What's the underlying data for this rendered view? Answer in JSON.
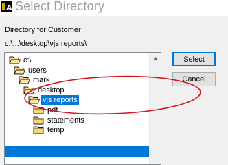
{
  "window": {
    "title": "Select Directory"
  },
  "dialog": {
    "label": "Directory for Customer",
    "current_path": "c:\\...\\desktop\\vjs reports\\"
  },
  "tree": {
    "nodes": [
      {
        "label": "c:\\",
        "depth": 0,
        "icon": "folder-open-icon"
      },
      {
        "label": "users",
        "depth": 1,
        "icon": "folder-open-icon"
      },
      {
        "label": "mark",
        "depth": 2,
        "icon": "folder-open-icon"
      },
      {
        "label": "desktop",
        "depth": 3,
        "icon": "folder-open-icon"
      },
      {
        "label": "vjs reports",
        "depth": 4,
        "icon": "folder-open-icon",
        "selected": true
      },
      {
        "label": "pdf",
        "depth": 5,
        "icon": "folder-closed-icon"
      },
      {
        "label": "statements",
        "depth": 5,
        "icon": "folder-closed-icon"
      },
      {
        "label": "temp",
        "depth": 5,
        "icon": "folder-closed-icon"
      }
    ]
  },
  "buttons": {
    "select": "Select",
    "cancel": "Cancel"
  },
  "colors": {
    "selection": "#0078d7",
    "annotation": "#d9141c",
    "folder": "#f5d67a"
  }
}
